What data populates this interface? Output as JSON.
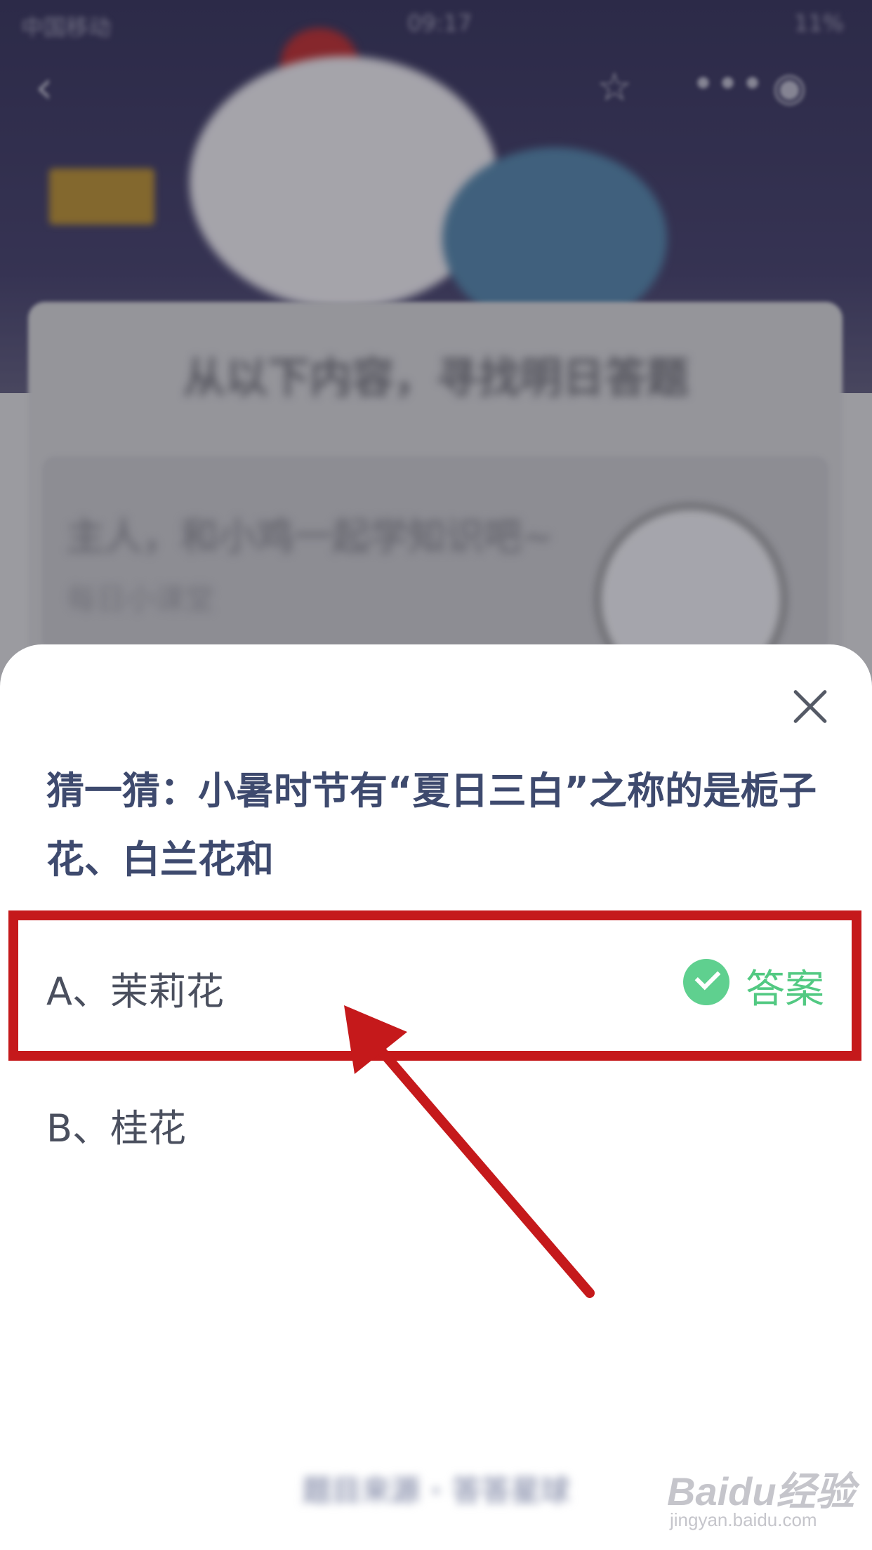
{
  "status_bar": {
    "carrier": "中国移动",
    "time": "09:17",
    "battery": "11%"
  },
  "background": {
    "banner_title": "从以下内容，寻找明日答题",
    "card_title": "主人，和小鸡一起学知识吧~",
    "card_subtitle": "每日小课堂"
  },
  "quiz": {
    "question": "猜一猜：小暑时节有“夏日三白”之称的是栀子花、白兰花和",
    "options": [
      {
        "label": "A、茉莉花",
        "is_answer": true,
        "answer_tag": "答案"
      },
      {
        "label": "B、桂花",
        "is_answer": false
      }
    ]
  },
  "footer": {
    "source_text": "题目来源 · 答答星球"
  },
  "watermark": {
    "logo": "Baidu经验",
    "url": "jingyan.baidu.com"
  },
  "colors": {
    "accent_green": "#52c982",
    "question_text": "#3e4a6e",
    "annotation_red": "#c5191b"
  }
}
